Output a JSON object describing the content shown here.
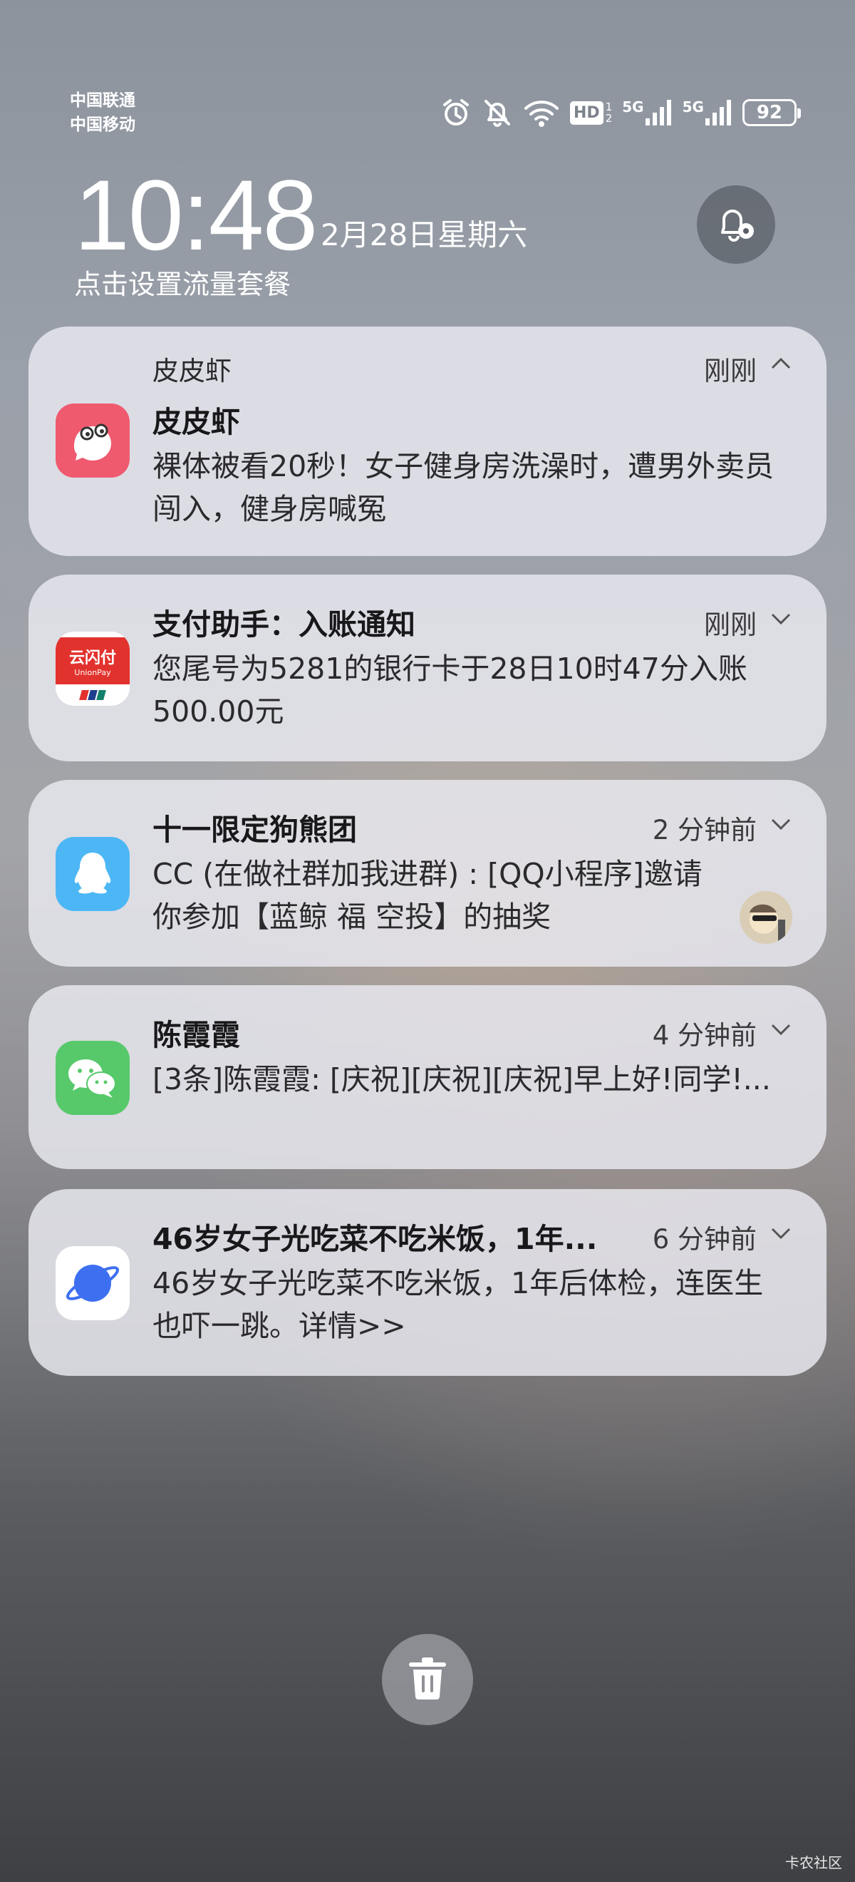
{
  "status_bar": {
    "carrier1": "中国联通",
    "carrier2": "中国移动",
    "hd_label": "HD",
    "net1": "5G",
    "net2": "5G",
    "battery": "92",
    "icons": [
      "alarm-icon",
      "bell-muted-icon",
      "wifi-icon",
      "hd-icon",
      "signal-icon",
      "signal-icon",
      "battery-icon"
    ]
  },
  "lockscreen": {
    "time": "10:48",
    "date": "2月28日星期六",
    "data_plan_prompt": "点击设置流量套餐"
  },
  "notifications": [
    {
      "app_name": "皮皮虾",
      "title": "皮皮虾",
      "body": "裸体被看20秒！女子健身房洗澡时，遭男外卖员闯入，健身房喊冤",
      "time": "刚刚",
      "icon": "pipixia-icon",
      "expanded": true
    },
    {
      "title": "支付助手：入账通知",
      "body": "您尾号为5281的银行卡于28日10时47分入账500.00元",
      "time": "刚刚",
      "icon": "unionpay-icon",
      "icon_text": "云闪付",
      "icon_subtext": "UnionPay"
    },
    {
      "title": "十一限定狗熊团",
      "body": "CC (在做社群加我进群) : [QQ小程序]邀请你参加【蓝鲸 福 空投】的抽奖",
      "time": "2 分钟前",
      "icon": "qq-icon"
    },
    {
      "title": "陈霞霞",
      "body": "[3条]陈霞霞: [庆祝][庆祝][庆祝]早上好!同学!...",
      "time": "4 分钟前",
      "icon": "wechat-icon"
    },
    {
      "title": "46岁女子光吃菜不吃米饭，1年...",
      "body": "46岁女子光吃菜不吃米饭，1年后体检，连医生也吓一跳。详情>>",
      "time": "6 分钟前",
      "icon": "browser-icon"
    }
  ],
  "watermark": "卡农社区",
  "colors": {
    "card_bg": "#e8e8f0",
    "pipixia": "#ef5a6f",
    "unionpay": "#e2322d",
    "qq": "#4db7f5",
    "wechat": "#57c96a",
    "browser": "#3d6ff0"
  }
}
